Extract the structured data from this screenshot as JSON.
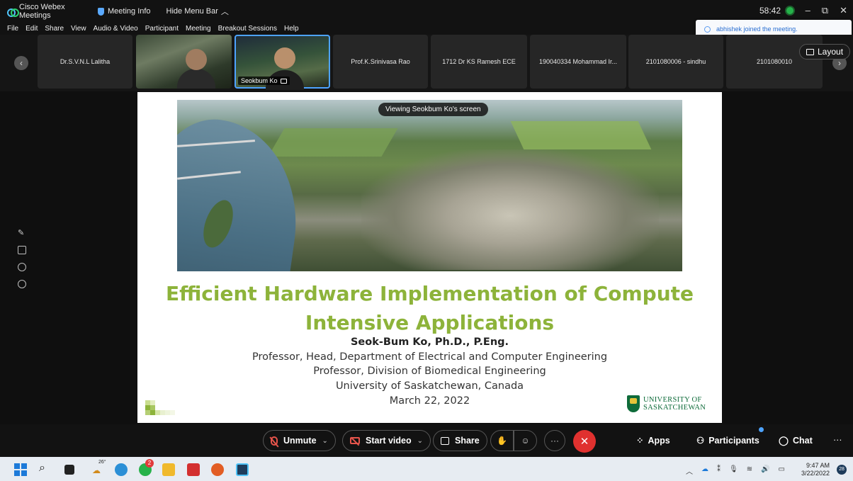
{
  "window": {
    "app_title": "Cisco Webex Meetings",
    "meeting_info": "Meeting Info",
    "hide_menu_bar": "Hide Menu Bar",
    "timer": "58:42"
  },
  "menu": [
    "File",
    "Edit",
    "Share",
    "View",
    "Audio & Video",
    "Participant",
    "Meeting",
    "Breakout Sessions",
    "Help"
  ],
  "toast": "abhishek joined the meeting.",
  "participants": [
    {
      "name": "Dr.S.V.N.L Lalitha",
      "video": false
    },
    {
      "name": "",
      "video": true
    },
    {
      "name": "Seokbum Ko",
      "video": true,
      "active": true
    },
    {
      "name": "Prof.K.Srinivasa Rao",
      "video": false
    },
    {
      "name": "1712 Dr KS Ramesh ECE",
      "video": false
    },
    {
      "name": "190040334 Mohammad Ir...",
      "video": false
    },
    {
      "name": "2101080006 - sindhu",
      "video": false
    },
    {
      "name": "2101080010",
      "video": false
    }
  ],
  "layout_label": "Layout",
  "viewing_label": "Viewing Seokbum Ko's screen",
  "slide": {
    "title_line1": "Efficient Hardware Implementation of Compute",
    "title_line2": "Intensive Applications",
    "author": "Seok-Bum Ko, Ph.D., P.Eng.",
    "line1": "Professor, Head, Department of Electrical and Computer Engineering",
    "line2": "Professor, Division of Biomedical Engineering",
    "line3": "University of Saskatchewan, Canada",
    "date": "March 22, 2022",
    "logo_line1": "UNIVERSITY OF",
    "logo_line2": "SASKATCHEWAN",
    "title_color": "#8db33a"
  },
  "controls": {
    "unmute": "Unmute",
    "start_video": "Start video",
    "share": "Share",
    "apps": "Apps",
    "participants": "Participants",
    "chat": "Chat",
    "end_color": "#e0312f"
  },
  "taskbar": {
    "weather": "26°",
    "whatsapp_badge": "2",
    "time": "9:47 AM",
    "date": "3/22/2022",
    "notif": "28"
  }
}
